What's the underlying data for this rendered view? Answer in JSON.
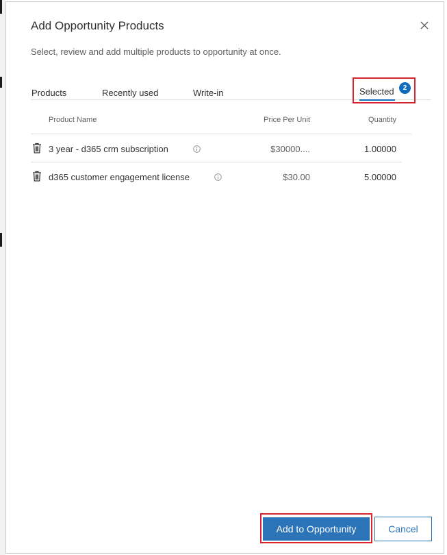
{
  "dialog": {
    "title": "Add Opportunity Products",
    "subtitle": "Select, review and add multiple products to opportunity at once."
  },
  "tabs": [
    {
      "label": "Products"
    },
    {
      "label": "Recently used"
    },
    {
      "label": "Write-in"
    },
    {
      "label": "Selected",
      "badge": "2",
      "active": true
    }
  ],
  "table": {
    "columns": {
      "name": "Product Name",
      "price": "Price Per Unit",
      "quantity": "Quantity"
    },
    "rows": [
      {
        "name": "3 year - d365 crm subscription",
        "price": "$30000....",
        "quantity": "1.00000"
      },
      {
        "name": "d365 customer engagement license",
        "price": "$30.00",
        "quantity": "5.00000"
      }
    ]
  },
  "footer": {
    "primary_label": "Add to Opportunity",
    "secondary_label": "Cancel"
  },
  "icons": {
    "close": "close-icon",
    "delete": "trash-icon",
    "info": "info-icon"
  },
  "colors": {
    "accent": "#2b74b8",
    "highlight": "#d9232e",
    "badge": "#0f6cbd"
  }
}
